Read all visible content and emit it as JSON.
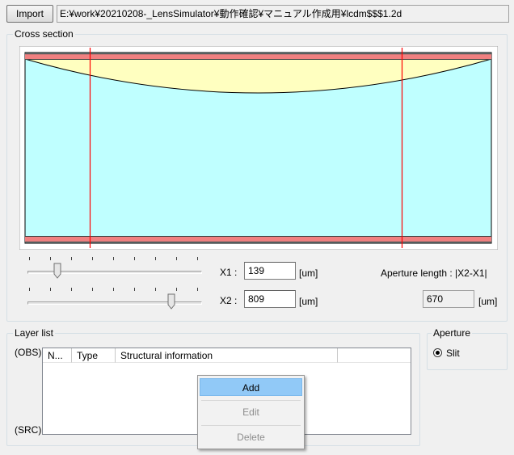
{
  "toolbar": {
    "import_label": "Import",
    "file_path": "E:¥work¥20210208-_LensSimulator¥動作確認¥マニュアル作成用¥lcdm$$$1.2d"
  },
  "cross_section": {
    "title": "Cross section",
    "x1_label": "X1 :",
    "x1_value": "139",
    "x1_unit": "[um]",
    "x2_label": "X2 :",
    "x2_value": "809",
    "x2_unit": "[um]",
    "aperture_length_label": "Aperture length : |X2-X1|",
    "aperture_length_value": "670",
    "aperture_length_unit": "[um]",
    "colors": {
      "substrate": "#bfffff",
      "lens": "#ffffc0",
      "electrode": "#f08080",
      "cursor": "#ff0000"
    }
  },
  "layer_list": {
    "title": "Layer list",
    "obs_label": "(OBS)",
    "src_label": "(SRC)",
    "columns": [
      "N...",
      "Type",
      "Structural information"
    ]
  },
  "aperture": {
    "title": "Aperture",
    "option_label": "Slit",
    "selected": true
  },
  "context_menu": {
    "items": [
      {
        "label": "Add",
        "enabled": true
      },
      {
        "label": "Edit",
        "enabled": false
      },
      {
        "label": "Delete",
        "enabled": false
      }
    ]
  }
}
